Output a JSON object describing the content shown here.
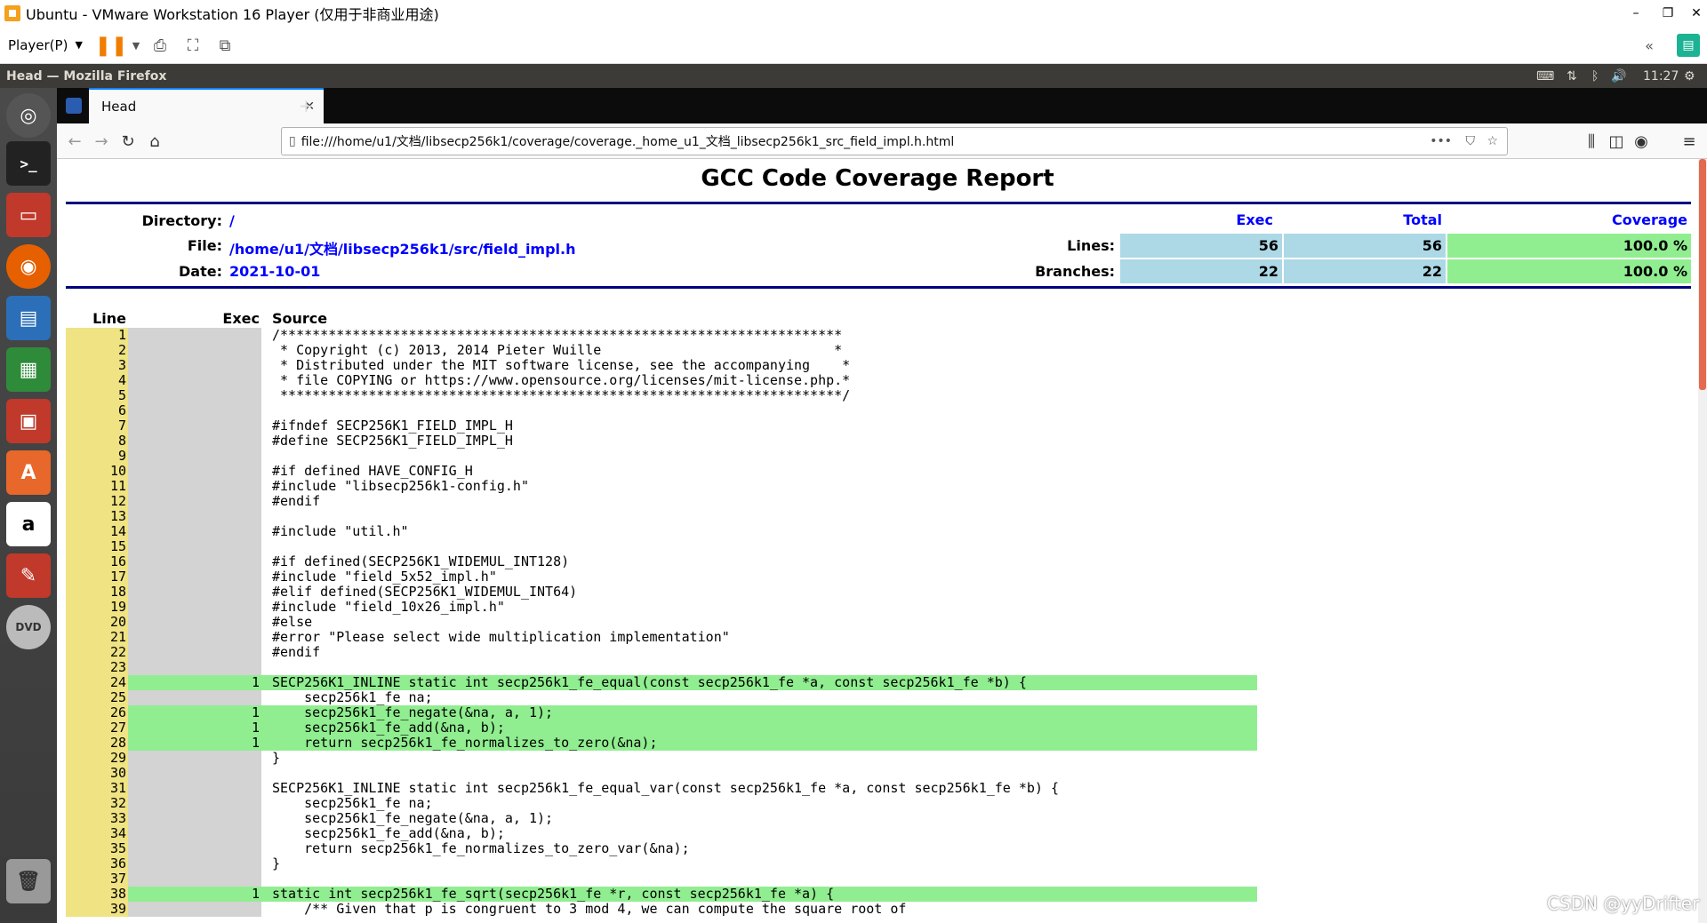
{
  "vm": {
    "title": "Ubuntu - VMware Workstation 16 Player (仅用于非商业用途)",
    "player_menu": "Player(P)",
    "min": "–",
    "max": "❐",
    "close": "✕"
  },
  "panel": {
    "window_title": "Head — Mozilla Firefox",
    "time": "11:27"
  },
  "browser": {
    "tab_title": "Head",
    "url": "file:///home/u1/文档/libsecp256k1/coverage/coverage._home_u1_文档_libsecp256k1_src_field_impl.h.html"
  },
  "report": {
    "title": "GCC Code Coverage Report",
    "directory_label": "Directory:",
    "directory_value": "/",
    "file_label": "File:",
    "file_value": "/home/u1/文档/libsecp256k1/src/field_impl.h",
    "date_label": "Date:",
    "date_value": "2021-10-01",
    "exec_header": "Exec",
    "total_header": "Total",
    "coverage_header": "Coverage",
    "lines_label": "Lines:",
    "lines_exec": "56",
    "lines_total": "56",
    "lines_coverage": "100.0 %",
    "branches_label": "Branches:",
    "branches_exec": "22",
    "branches_total": "22",
    "branches_coverage": "100.0 %",
    "col_line": "Line",
    "col_exec": "Exec",
    "col_source": "Source"
  },
  "source_lines": [
    {
      "n": "1",
      "e": "",
      "c": "/**********************************************************************"
    },
    {
      "n": "2",
      "e": "",
      "c": " * Copyright (c) 2013, 2014 Pieter Wuille                             *"
    },
    {
      "n": "3",
      "e": "",
      "c": " * Distributed under the MIT software license, see the accompanying    *"
    },
    {
      "n": "4",
      "e": "",
      "c": " * file COPYING or https://www.opensource.org/licenses/mit-license.php.*"
    },
    {
      "n": "5",
      "e": "",
      "c": " **********************************************************************/"
    },
    {
      "n": "6",
      "e": "",
      "c": ""
    },
    {
      "n": "7",
      "e": "",
      "c": "#ifndef SECP256K1_FIELD_IMPL_H"
    },
    {
      "n": "8",
      "e": "",
      "c": "#define SECP256K1_FIELD_IMPL_H"
    },
    {
      "n": "9",
      "e": "",
      "c": ""
    },
    {
      "n": "10",
      "e": "",
      "c": "#if defined HAVE_CONFIG_H"
    },
    {
      "n": "11",
      "e": "",
      "c": "#include \"libsecp256k1-config.h\""
    },
    {
      "n": "12",
      "e": "",
      "c": "#endif"
    },
    {
      "n": "13",
      "e": "",
      "c": ""
    },
    {
      "n": "14",
      "e": "",
      "c": "#include \"util.h\""
    },
    {
      "n": "15",
      "e": "",
      "c": ""
    },
    {
      "n": "16",
      "e": "",
      "c": "#if defined(SECP256K1_WIDEMUL_INT128)"
    },
    {
      "n": "17",
      "e": "",
      "c": "#include \"field_5x52_impl.h\""
    },
    {
      "n": "18",
      "e": "",
      "c": "#elif defined(SECP256K1_WIDEMUL_INT64)"
    },
    {
      "n": "19",
      "e": "",
      "c": "#include \"field_10x26_impl.h\""
    },
    {
      "n": "20",
      "e": "",
      "c": "#else"
    },
    {
      "n": "21",
      "e": "",
      "c": "#error \"Please select wide multiplication implementation\""
    },
    {
      "n": "22",
      "e": "",
      "c": "#endif"
    },
    {
      "n": "23",
      "e": "",
      "c": ""
    },
    {
      "n": "24",
      "e": "1",
      "c": "SECP256K1_INLINE static int secp256k1_fe_equal(const secp256k1_fe *a, const secp256k1_fe *b) {"
    },
    {
      "n": "25",
      "e": "",
      "c": "    secp256k1_fe na;"
    },
    {
      "n": "26",
      "e": "1",
      "c": "    secp256k1_fe_negate(&na, a, 1);"
    },
    {
      "n": "27",
      "e": "1",
      "c": "    secp256k1_fe_add(&na, b);"
    },
    {
      "n": "28",
      "e": "1",
      "c": "    return secp256k1_fe_normalizes_to_zero(&na);"
    },
    {
      "n": "29",
      "e": "",
      "c": "}"
    },
    {
      "n": "30",
      "e": "",
      "c": ""
    },
    {
      "n": "31",
      "e": "",
      "c": "SECP256K1_INLINE static int secp256k1_fe_equal_var(const secp256k1_fe *a, const secp256k1_fe *b) {"
    },
    {
      "n": "32",
      "e": "",
      "c": "    secp256k1_fe na;"
    },
    {
      "n": "33",
      "e": "",
      "c": "    secp256k1_fe_negate(&na, a, 1);"
    },
    {
      "n": "34",
      "e": "",
      "c": "    secp256k1_fe_add(&na, b);"
    },
    {
      "n": "35",
      "e": "",
      "c": "    return secp256k1_fe_normalizes_to_zero_var(&na);"
    },
    {
      "n": "36",
      "e": "",
      "c": "}"
    },
    {
      "n": "37",
      "e": "",
      "c": ""
    },
    {
      "n": "38",
      "e": "1",
      "c": "static int secp256k1_fe_sqrt(secp256k1_fe *r, const secp256k1_fe *a) {"
    },
    {
      "n": "39",
      "e": "",
      "c": "    /** Given that p is congruent to 3 mod 4, we can compute the square root of"
    }
  ],
  "watermark": "CSDN @yyDrifter"
}
